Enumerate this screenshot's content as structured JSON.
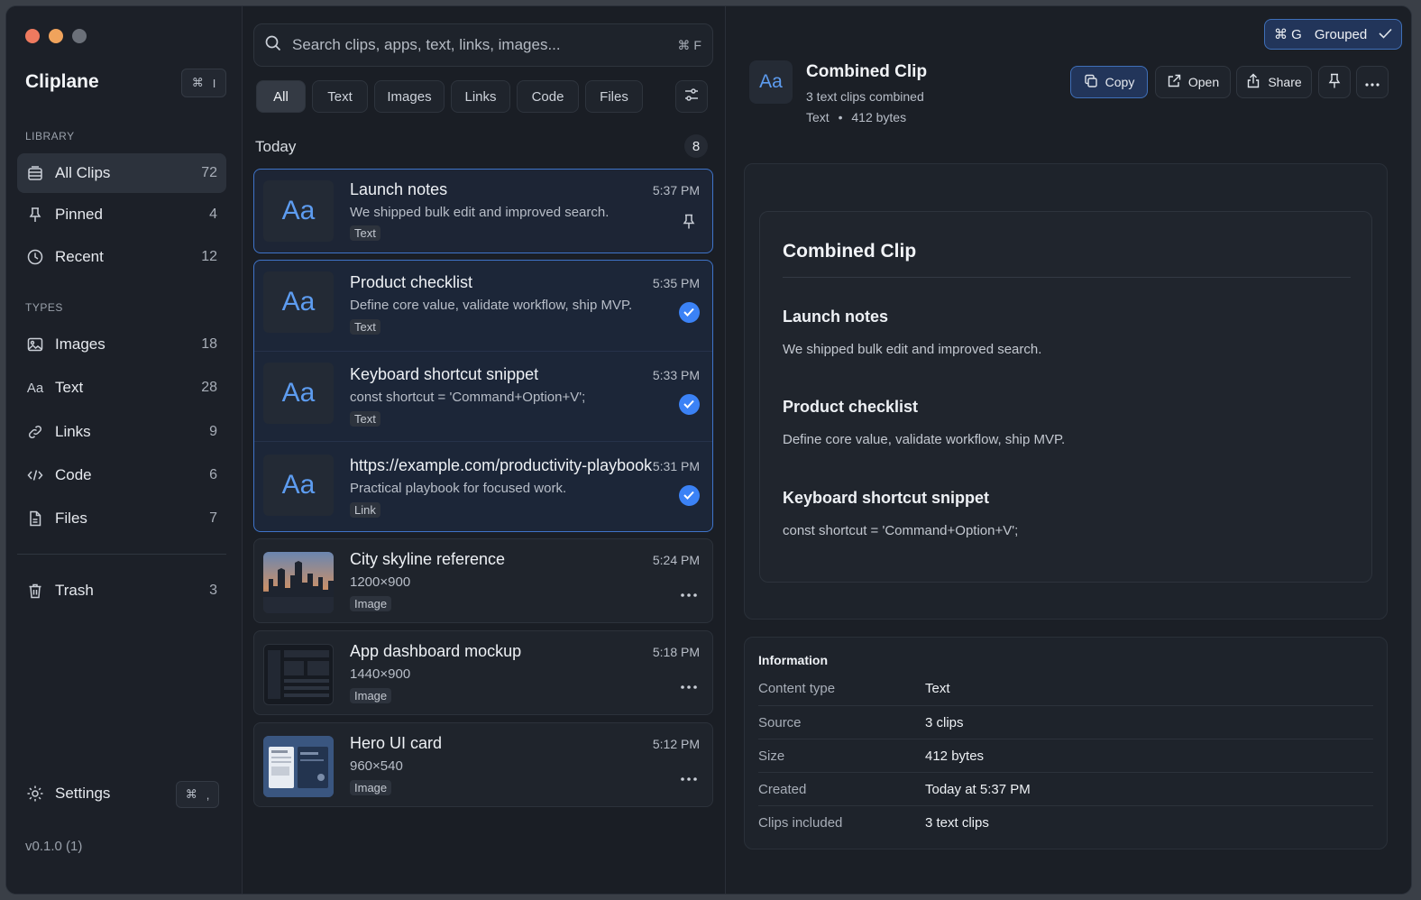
{
  "app": {
    "title": "Cliplane",
    "shortcut_mod": "⌘",
    "shortcut_key": "I",
    "version": "v0.1.0 (1)"
  },
  "sidebar": {
    "library_label": "LIBRARY",
    "types_label": "TYPES",
    "library": [
      {
        "label": "All Clips",
        "count": "72",
        "icon": "clipboard-icon",
        "active": true
      },
      {
        "label": "Pinned",
        "count": "4",
        "icon": "pin-icon"
      },
      {
        "label": "Recent",
        "count": "12",
        "icon": "clock-icon"
      }
    ],
    "types": [
      {
        "label": "Images",
        "count": "18",
        "icon": "image-icon"
      },
      {
        "label": "Text",
        "count": "28",
        "icon": "text-icon",
        "glyph": "Aa"
      },
      {
        "label": "Links",
        "count": "9",
        "icon": "link-icon"
      },
      {
        "label": "Code",
        "count": "6",
        "icon": "code-icon"
      },
      {
        "label": "Files",
        "count": "7",
        "icon": "file-icon"
      }
    ],
    "trash": {
      "label": "Trash",
      "count": "3",
      "icon": "trash-icon"
    },
    "settings": {
      "label": "Settings",
      "shortcut_mod": "⌘",
      "shortcut_key": ","
    }
  },
  "search": {
    "placeholder": "Search clips, apps, text, links, images...",
    "shortcut": "⌘ F"
  },
  "filters": [
    "All",
    "Text",
    "Images",
    "Links",
    "Code",
    "Files"
  ],
  "list": {
    "section_label": "Today",
    "section_count": "8",
    "items": [
      {
        "title": "Launch notes",
        "subtitle": "We shipped bulk edit and improved search.",
        "tag": "Text",
        "time": "5:37 PM",
        "thumb": "Aa"
      },
      {
        "title": "Product checklist",
        "subtitle": "Define core value, validate workflow, ship MVP.",
        "tag": "Text",
        "time": "5:35 PM",
        "thumb": "Aa"
      },
      {
        "title": "Keyboard shortcut snippet",
        "subtitle": "const shortcut = 'Command+Option+V';",
        "tag": "Text",
        "time": "5:33 PM",
        "thumb": "Aa"
      },
      {
        "title": "https://example.com/productivity-playbook",
        "subtitle": "Practical playbook for focused work.",
        "tag": "Link",
        "time": "5:31 PM",
        "thumb": "Aa"
      },
      {
        "title": "City skyline reference",
        "subtitle": "1200×900",
        "tag": "Image",
        "time": "5:24 PM"
      },
      {
        "title": "App dashboard mockup",
        "subtitle": "1440×900",
        "tag": "Image",
        "time": "5:18 PM"
      },
      {
        "title": "Hero UI card",
        "subtitle": "960×540",
        "tag": "Image",
        "time": "5:12 PM"
      }
    ]
  },
  "detail": {
    "grouped_shortcut": "⌘ G",
    "grouped_label": "Grouped",
    "icon_glyph": "Aa",
    "title": "Combined Clip",
    "subtitle": "3 text clips combined",
    "meta_type": "Text",
    "meta_sep": "•",
    "meta_size": "412 bytes",
    "actions": {
      "copy": "Copy",
      "open": "Open",
      "share": "Share"
    },
    "preview": {
      "heading": "Combined Clip",
      "sections": [
        {
          "title": "Launch notes",
          "body": "We shipped bulk edit and improved search."
        },
        {
          "title": "Product checklist",
          "body": "Define core value, validate workflow, ship MVP."
        },
        {
          "title": "Keyboard shortcut snippet",
          "body": "const shortcut = 'Command+Option+V';"
        }
      ]
    },
    "info": {
      "heading": "Information",
      "rows": [
        {
          "key": "Content type",
          "value": "Text"
        },
        {
          "key": "Source",
          "value": "3 clips"
        },
        {
          "key": "Size",
          "value": "412 bytes"
        },
        {
          "key": "Created",
          "value": "Today at 5:37 PM"
        },
        {
          "key": "Clips included",
          "value": "3 text clips"
        }
      ]
    }
  },
  "colors": {
    "accent": "#3b82f6",
    "background": "#1a1e25"
  }
}
